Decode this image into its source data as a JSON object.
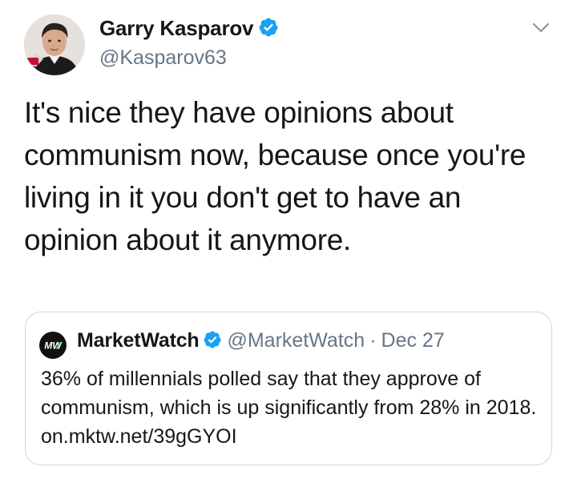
{
  "tweet": {
    "author": {
      "name": "Garry Kasparov",
      "handle": "@Kasparov63",
      "verified": true
    },
    "text": "It's nice they have opinions about communism now, because once you're living in it you don't get to have an opinion about it anymore.",
    "icons": {
      "verified": "verified-badge-icon",
      "menu": "chevron-down-icon"
    }
  },
  "quoted_tweet": {
    "author": {
      "name": "MarketWatch",
      "handle": "@MarketWatch",
      "verified": true
    },
    "separator": "·",
    "date": "Dec 27",
    "text": "36% of millennials polled say that they approve of communism, which is up significantly from 28% in 2018. on.mktw.net/39gGYOI",
    "logo_text": "MW"
  },
  "colors": {
    "text": "#14171a",
    "secondary": "#657786",
    "verified": "#1da1f2",
    "border": "#ccd6dd"
  }
}
